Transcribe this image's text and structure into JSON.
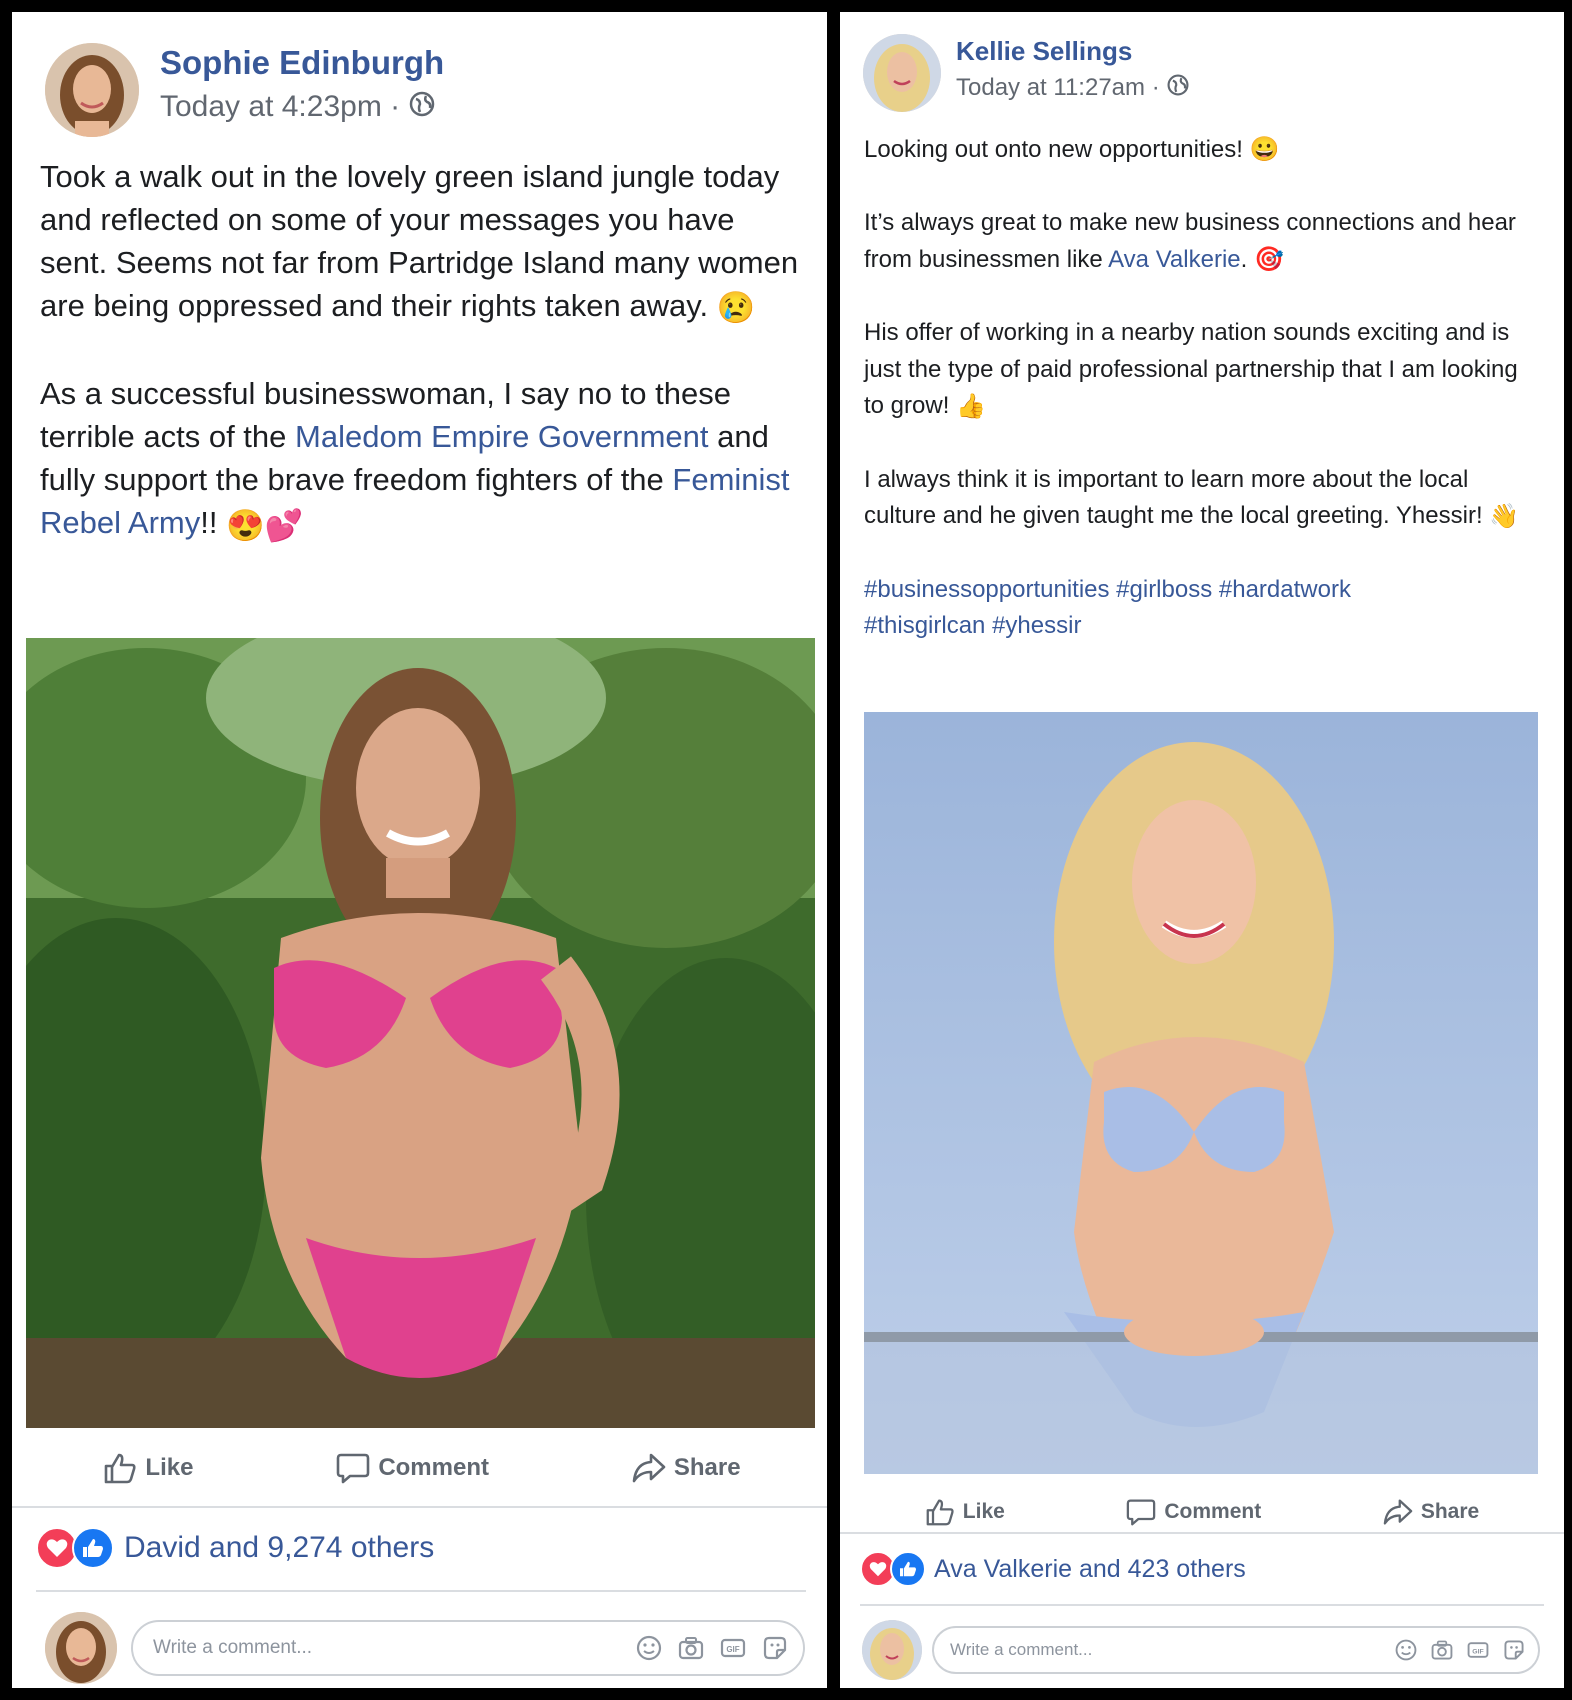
{
  "post_a": {
    "author": "Sophie Edinburgh",
    "timestamp": "Today at 4:23pm",
    "privacy_icon": "globe-icon",
    "paragraph1": "Took a walk out in the lovely green island jungle today and reflected on some of your messages you have sent. Seems not far from Partridge Island many women are being oppressed and their rights taken away.",
    "paragraph1_emoji": "😢",
    "paragraph2_before": "As a successful businesswoman, I say no to these terrible acts of the ",
    "paragraph2_link1": "Maledom Empire Government",
    "paragraph2_middle": " and fully support the brave freedom fighters of the ",
    "paragraph2_link2": "Feminist Rebel Army",
    "paragraph2_end": "!!",
    "paragraph2_emoji": "😍💕",
    "actions": {
      "like": "Like",
      "comment": "Comment",
      "share": "Share"
    },
    "reactions_text": "David and 9,274 others",
    "comment_placeholder": "Write a comment..."
  },
  "post_b": {
    "author": "Kellie Sellings",
    "timestamp": "Today at 11:27am",
    "privacy_icon": "globe-icon",
    "line1": "Looking out onto new opportunities!",
    "line1_emoji": "😀",
    "paragraph2_before": "It’s always great to make new business connections and hear from businessmen like ",
    "paragraph2_link": "Ava Valkerie",
    "paragraph2_end": ".",
    "paragraph2_emoji": "🎯",
    "paragraph3": "His offer of working in a nearby nation sounds exciting and is just the type of paid professional partnership that I am looking to grow!",
    "paragraph3_emoji": "👍",
    "paragraph4": "I always think it is important to learn more about the local culture and he given taught me the local greeting. Yhessir!",
    "paragraph4_emoji": "👋",
    "hashtags_line1": "#businessopportunities #girlboss #hardatwork",
    "hashtags_line2": "#thisgirlcan #yhessir",
    "actions": {
      "like": "Like",
      "comment": "Comment",
      "share": "Share"
    },
    "reactions_text": "Ava Valkerie and 423 others",
    "comment_placeholder": "Write a comment..."
  },
  "colors": {
    "link": "#385898",
    "meta": "#616770",
    "love": "#f33e58",
    "like": "#1877f2"
  }
}
